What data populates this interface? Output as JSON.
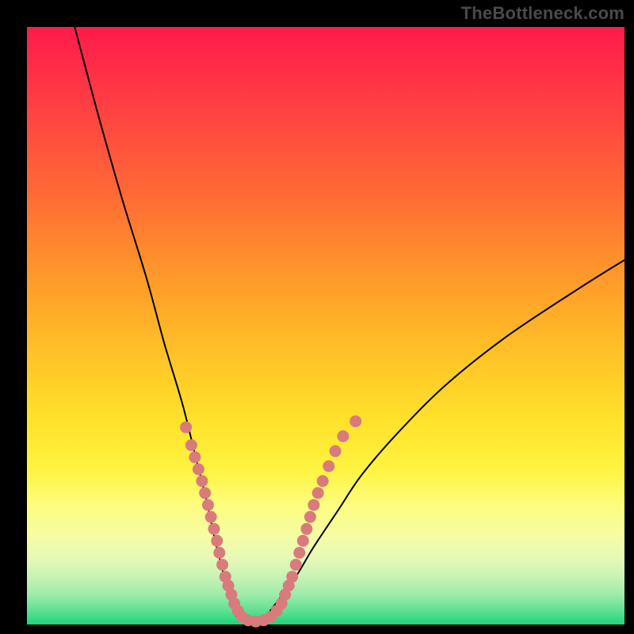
{
  "watermark": "TheBottleneck.com",
  "chart_data": {
    "type": "line",
    "title": "",
    "xlabel": "",
    "ylabel": "",
    "xlim": [
      0,
      100
    ],
    "ylim": [
      0,
      100
    ],
    "grid": false,
    "legend": false,
    "annotations": [],
    "gradient_stops": [
      {
        "pos": 0,
        "color": "#ff1a4b"
      },
      {
        "pos": 28,
        "color": "#ff6a35"
      },
      {
        "pos": 55,
        "color": "#ffc327"
      },
      {
        "pos": 74,
        "color": "#fff341"
      },
      {
        "pos": 100,
        "color": "#1cd67a"
      }
    ],
    "series": [
      {
        "name": "curve",
        "color": "#000000",
        "x": [
          8,
          12,
          16,
          20,
          23,
          26,
          28,
          30,
          31.5,
          33,
          34,
          35,
          36,
          38,
          40,
          42,
          45,
          48,
          52,
          56,
          62,
          70,
          80,
          92,
          100
        ],
        "y": [
          100,
          85,
          71,
          58,
          47,
          37,
          29,
          21,
          14,
          8,
          4,
          1.5,
          0.5,
          0.5,
          1.5,
          4,
          8,
          13,
          19,
          25,
          32,
          40,
          48,
          56,
          61
        ]
      }
    ],
    "markers": {
      "name": "dots",
      "color": "#d97b7d",
      "radius": 1.0,
      "x": [
        26.6,
        27.5,
        28.1,
        28.7,
        29.3,
        29.8,
        30.3,
        30.8,
        31.3,
        31.8,
        32.2,
        32.7,
        33.2,
        33.7,
        34.2,
        34.7,
        35.3,
        36.0,
        37.0,
        38.3,
        39.6,
        40.8,
        41.8,
        42.6,
        43.2,
        43.8,
        44.4,
        45.0,
        45.6,
        46.2,
        46.8,
        47.4,
        48.0,
        48.7,
        49.5,
        50.5,
        51.6,
        52.9,
        55.0
      ],
      "y": [
        33.0,
        30.0,
        28.0,
        26.0,
        24.0,
        22.0,
        20.0,
        18.0,
        16.0,
        14.0,
        12.0,
        10.0,
        8.0,
        6.5,
        5.0,
        3.5,
        2.3,
        1.3,
        0.7,
        0.5,
        0.7,
        1.3,
        2.3,
        3.5,
        5.0,
        6.5,
        8.0,
        10.0,
        12.0,
        14.0,
        16.0,
        18.0,
        20.0,
        22.0,
        24.0,
        26.5,
        29.0,
        31.5,
        34.0
      ]
    }
  }
}
